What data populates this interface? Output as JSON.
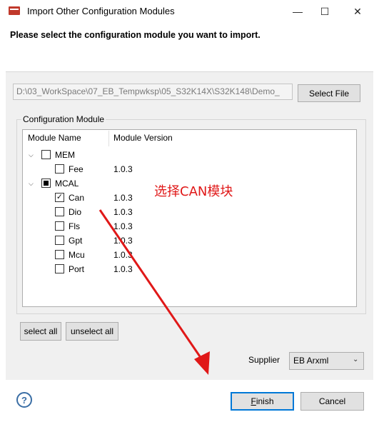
{
  "window": {
    "title": "Import Other Configuration Modules",
    "minimize_glyph": "—",
    "maximize_glyph": "☐",
    "close_glyph": "✕"
  },
  "instruction": "Please select the configuration module you want to import.",
  "path_field": {
    "value": "D:\\03_WorkSpace\\07_EB_Tempwksp\\05_S32K14X\\S32K148\\Demo_"
  },
  "select_file_label": "Select File",
  "group": {
    "title": "Configuration Module",
    "columns": [
      "Module Name",
      "Module Version"
    ]
  },
  "tree": [
    {
      "name": "MEM",
      "version": "",
      "level": 0,
      "expanded": true,
      "checked": "unchecked"
    },
    {
      "name": "Fee",
      "version": "1.0.3",
      "level": 1,
      "checked": "unchecked"
    },
    {
      "name": "MCAL",
      "version": "",
      "level": 0,
      "expanded": true,
      "checked": "partial"
    },
    {
      "name": "Can",
      "version": "1.0.3",
      "level": 1,
      "checked": "checked"
    },
    {
      "name": "Dio",
      "version": "1.0.3",
      "level": 1,
      "checked": "unchecked"
    },
    {
      "name": "Fls",
      "version": "1.0.3",
      "level": 1,
      "checked": "unchecked"
    },
    {
      "name": "Gpt",
      "version": "1.0.3",
      "level": 1,
      "checked": "unchecked"
    },
    {
      "name": "Mcu",
      "version": "1.0.3",
      "level": 1,
      "checked": "unchecked"
    },
    {
      "name": "Port",
      "version": "1.0.3",
      "level": 1,
      "checked": "unchecked"
    }
  ],
  "annotation": "选择CAN模块",
  "select_all_label": "select all",
  "unselect_all_label": "unselect all",
  "supplier": {
    "label": "Supplier",
    "value": "EB Arxml"
  },
  "help_glyph": "?",
  "finish": {
    "mnemonic": "F",
    "rest": "inish"
  },
  "cancel_label": "Cancel",
  "colors": {
    "annotation": "#e01818",
    "focus_border": "#0078d7",
    "panel_bg": "#f0f0f0"
  }
}
